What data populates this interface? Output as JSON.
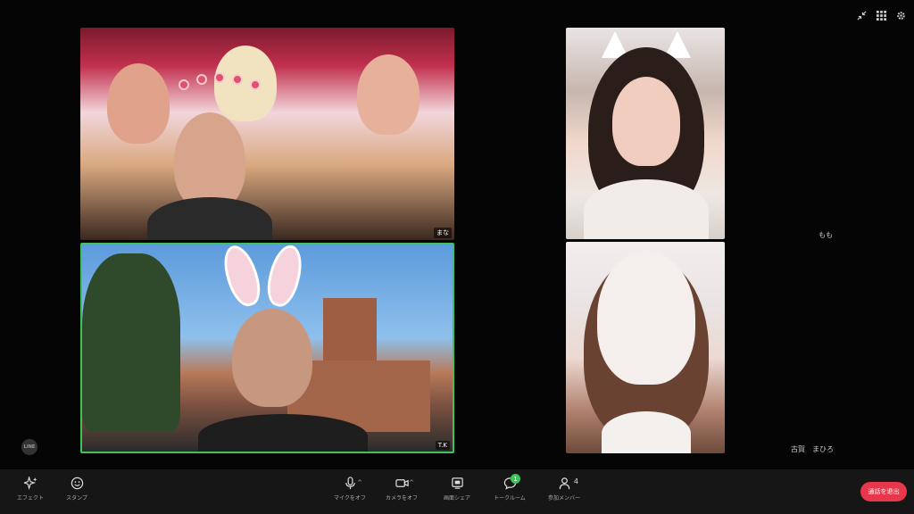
{
  "tiles": {
    "top_left": {
      "name": "まな"
    },
    "bottom_left": {
      "name": "T.K"
    },
    "top_right": {
      "name": ""
    },
    "bottom_right": {
      "name": ""
    }
  },
  "side_names": {
    "upper": "もも",
    "lower": "古賀　まひろ"
  },
  "top_controls": [
    "minimize-icon",
    "grid-view-icon",
    "settings-icon"
  ],
  "brand": {
    "label": "LINE"
  },
  "toolbar": {
    "effects_label": "エフェクト",
    "stamp_label": "スタンプ",
    "mic_label": "マイクをオフ",
    "camera_label": "カメラをオフ",
    "share_label": "画面シェア",
    "chat_label": "トークルーム",
    "chat_badge": "1",
    "members_label": "参加メンバー",
    "members_count": "4",
    "leave_label": "通話を退出"
  },
  "colors": {
    "active_speaker": "#3ec25a",
    "leave": "#e8364a"
  }
}
